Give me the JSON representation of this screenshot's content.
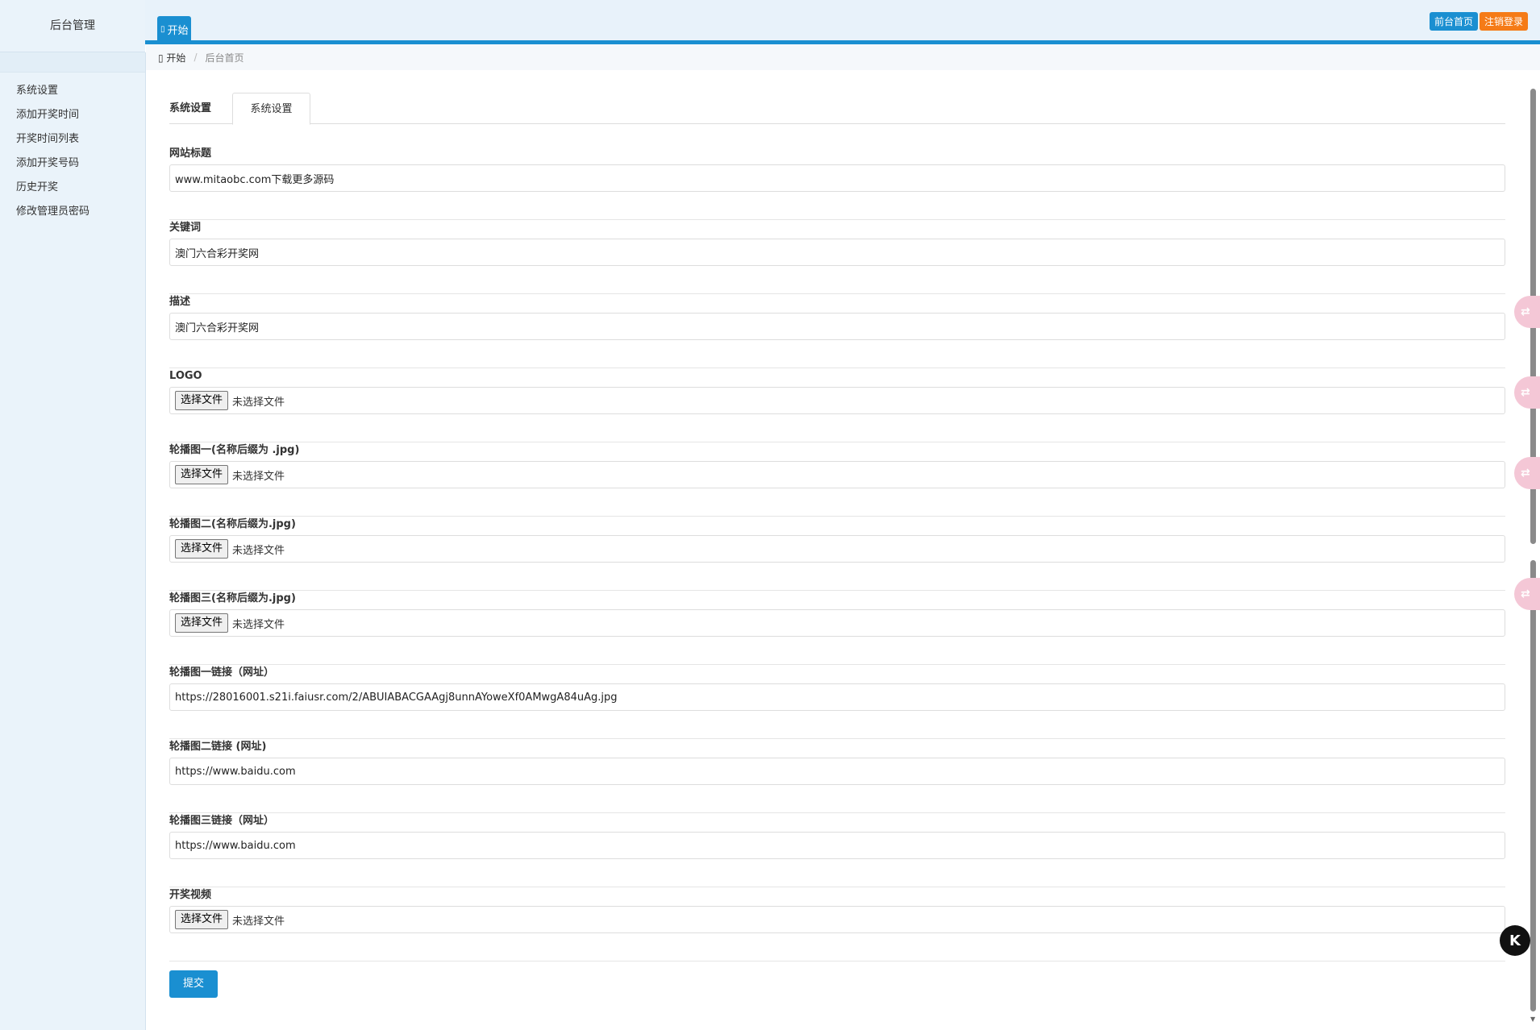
{
  "header": {
    "brand": "后台管理",
    "tab_label": "开始",
    "front_button": "前台首页",
    "logout_button": "注销登录"
  },
  "sidebar": {
    "items": [
      {
        "label": "系统设置"
      },
      {
        "label": "添加开奖时间"
      },
      {
        "label": "开奖时间列表"
      },
      {
        "label": "添加开奖号码"
      },
      {
        "label": "历史开奖"
      },
      {
        "label": "修改管理员密码"
      }
    ]
  },
  "breadcrumb": {
    "home": "开始",
    "current": "后台首页"
  },
  "main": {
    "tabs": [
      {
        "label": "系统设置"
      },
      {
        "label": "系统设置"
      }
    ],
    "fields": {
      "site_title": {
        "label": "网站标题",
        "value": "www.mitaobc.com下载更多源码"
      },
      "keywords": {
        "label": "关键词",
        "value": "澳门六合彩开奖网"
      },
      "description": {
        "label": "描述",
        "value": "澳门六合彩开奖网"
      },
      "logo": {
        "label": "LOGO",
        "button": "选择文件",
        "status": "未选择文件"
      },
      "banner1": {
        "label": "轮播图一(名称后缀为 .jpg)",
        "button": "选择文件",
        "status": "未选择文件"
      },
      "banner2": {
        "label": "轮播图二(名称后缀为.jpg)",
        "button": "选择文件",
        "status": "未选择文件"
      },
      "banner3": {
        "label": "轮播图三(名称后缀为.jpg)",
        "button": "选择文件",
        "status": "未选择文件"
      },
      "banner1_link": {
        "label": "轮播图一链接（网址）",
        "value": "https://28016001.s21i.faiusr.com/2/ABUIABACGAAgj8unnAYoweXf0AMwgA84uAg.jpg"
      },
      "banner2_link": {
        "label": "轮播图二链接 (网址)",
        "value": "https://www.baidu.com"
      },
      "banner3_link": {
        "label": "轮播图三链接（网址）",
        "value": "https://www.baidu.com"
      },
      "video": {
        "label": "开奖视频",
        "button": "选择文件",
        "status": "未选择文件"
      }
    },
    "submit": "提交"
  },
  "colors": {
    "accent": "#1a8fd1",
    "logout": "#f57b17",
    "sidebar_bg": "#eaf3fa"
  },
  "floating": {
    "k_button": "K"
  }
}
